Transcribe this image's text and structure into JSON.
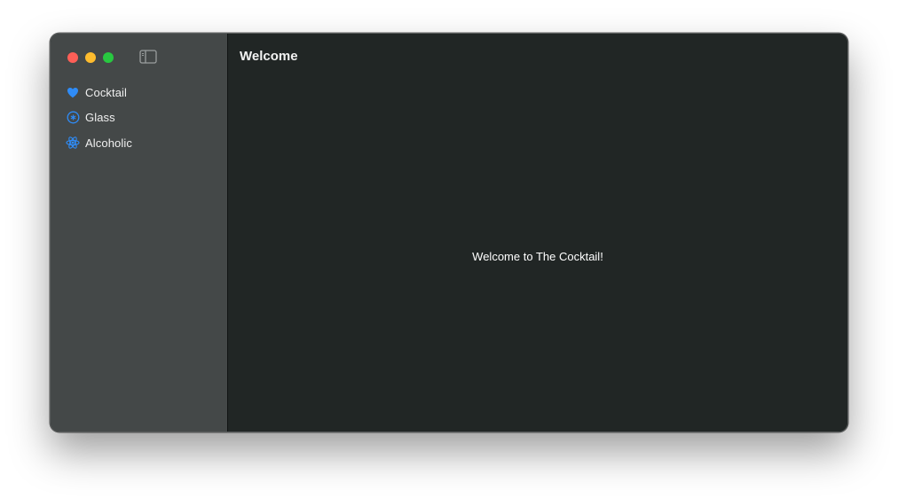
{
  "window": {
    "title": "Welcome"
  },
  "sidebar": {
    "items": [
      {
        "label": "Cocktail",
        "icon": "heart-icon"
      },
      {
        "label": "Glass",
        "icon": "star-circle-icon"
      },
      {
        "label": "Alcoholic",
        "icon": "atom-icon"
      }
    ]
  },
  "main": {
    "message": "Welcome to The Cocktail!"
  },
  "colors": {
    "accent": "#2f8cf7",
    "sidebar_bg": "#444848",
    "content_bg": "#212625",
    "close": "#fe5f57",
    "minimize": "#febc2e",
    "maximize": "#28c840"
  }
}
